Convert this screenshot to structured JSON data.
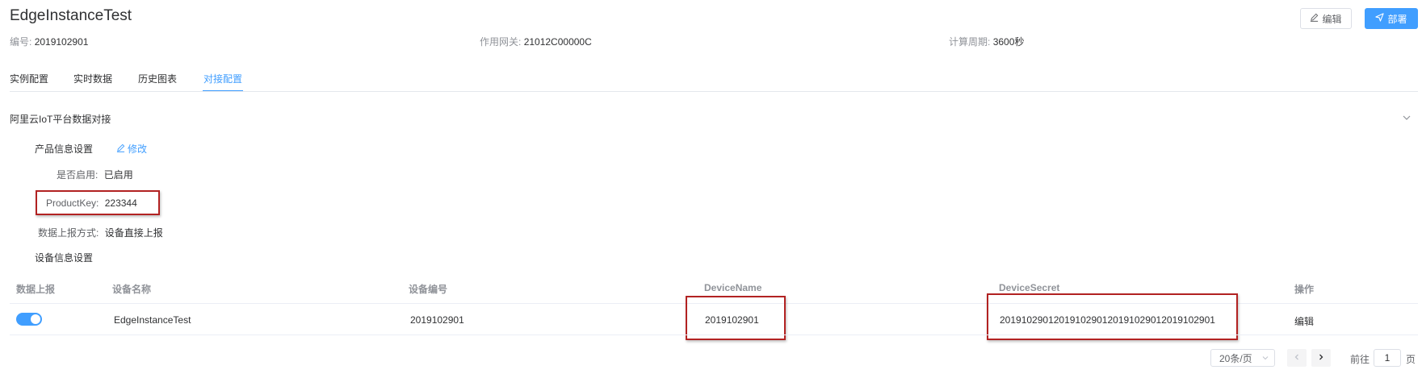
{
  "header": {
    "title": "EdgeInstanceTest",
    "edit_label": "编辑",
    "deploy_label": "部署",
    "meta": [
      {
        "label": "编号:",
        "value": "2019102901"
      },
      {
        "label": "作用网关:",
        "value": "21012C00000C"
      },
      {
        "label": "计算周期:",
        "value": "3600秒"
      }
    ]
  },
  "tabs": [
    "实例配置",
    "实时数据",
    "历史图表",
    "对接配置"
  ],
  "active_tab": "对接配置",
  "section": {
    "title": "阿里云IoT平台数据对接",
    "product_settings_label": "产品信息设置",
    "modify_label": "修改",
    "fields": [
      {
        "label": "是否启用:",
        "value": "已启用"
      },
      {
        "label": "ProductKey:",
        "value": "223344"
      },
      {
        "label": "数据上报方式:",
        "value": "设备直接上报"
      }
    ],
    "device_settings_label": "设备信息设置"
  },
  "table": {
    "columns": [
      "数据上报",
      "设备名称",
      "设备编号",
      "DeviceName",
      "DeviceSecret",
      "操作"
    ],
    "rows": [
      {
        "report_enabled": true,
        "name": "EdgeInstanceTest",
        "number": "2019102901",
        "device_name": "2019102901",
        "device_secret": "2019102901201910290120191029012019102901",
        "action": "编辑"
      }
    ]
  },
  "pagination": {
    "page_size": "20条/页",
    "goto_prefix": "前往",
    "page": "1",
    "goto_suffix": "页"
  },
  "colors": {
    "accent": "#409eff",
    "highlight_box": "#b22222"
  }
}
